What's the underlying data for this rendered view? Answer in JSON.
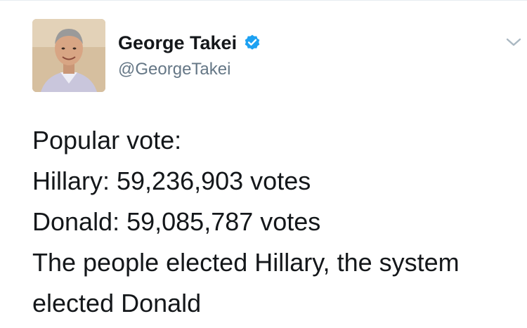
{
  "author": {
    "display_name": "George Takei",
    "handle": "@GeorgeTakei",
    "verified": true,
    "avatar_icon": "profile-photo"
  },
  "tweet": {
    "lines": [
      "Popular vote:",
      "Hillary: 59,236,903 votes",
      "Donald: 59,085,787 votes",
      "The people elected Hillary, the system",
      "elected Donald"
    ]
  },
  "colors": {
    "verified_badge": "#1da1f2",
    "handle": "#657786",
    "text": "#14171a",
    "caret": "#aab8c2"
  },
  "icons": {
    "verified": "verified-check-icon",
    "menu": "chevron-down-icon"
  }
}
